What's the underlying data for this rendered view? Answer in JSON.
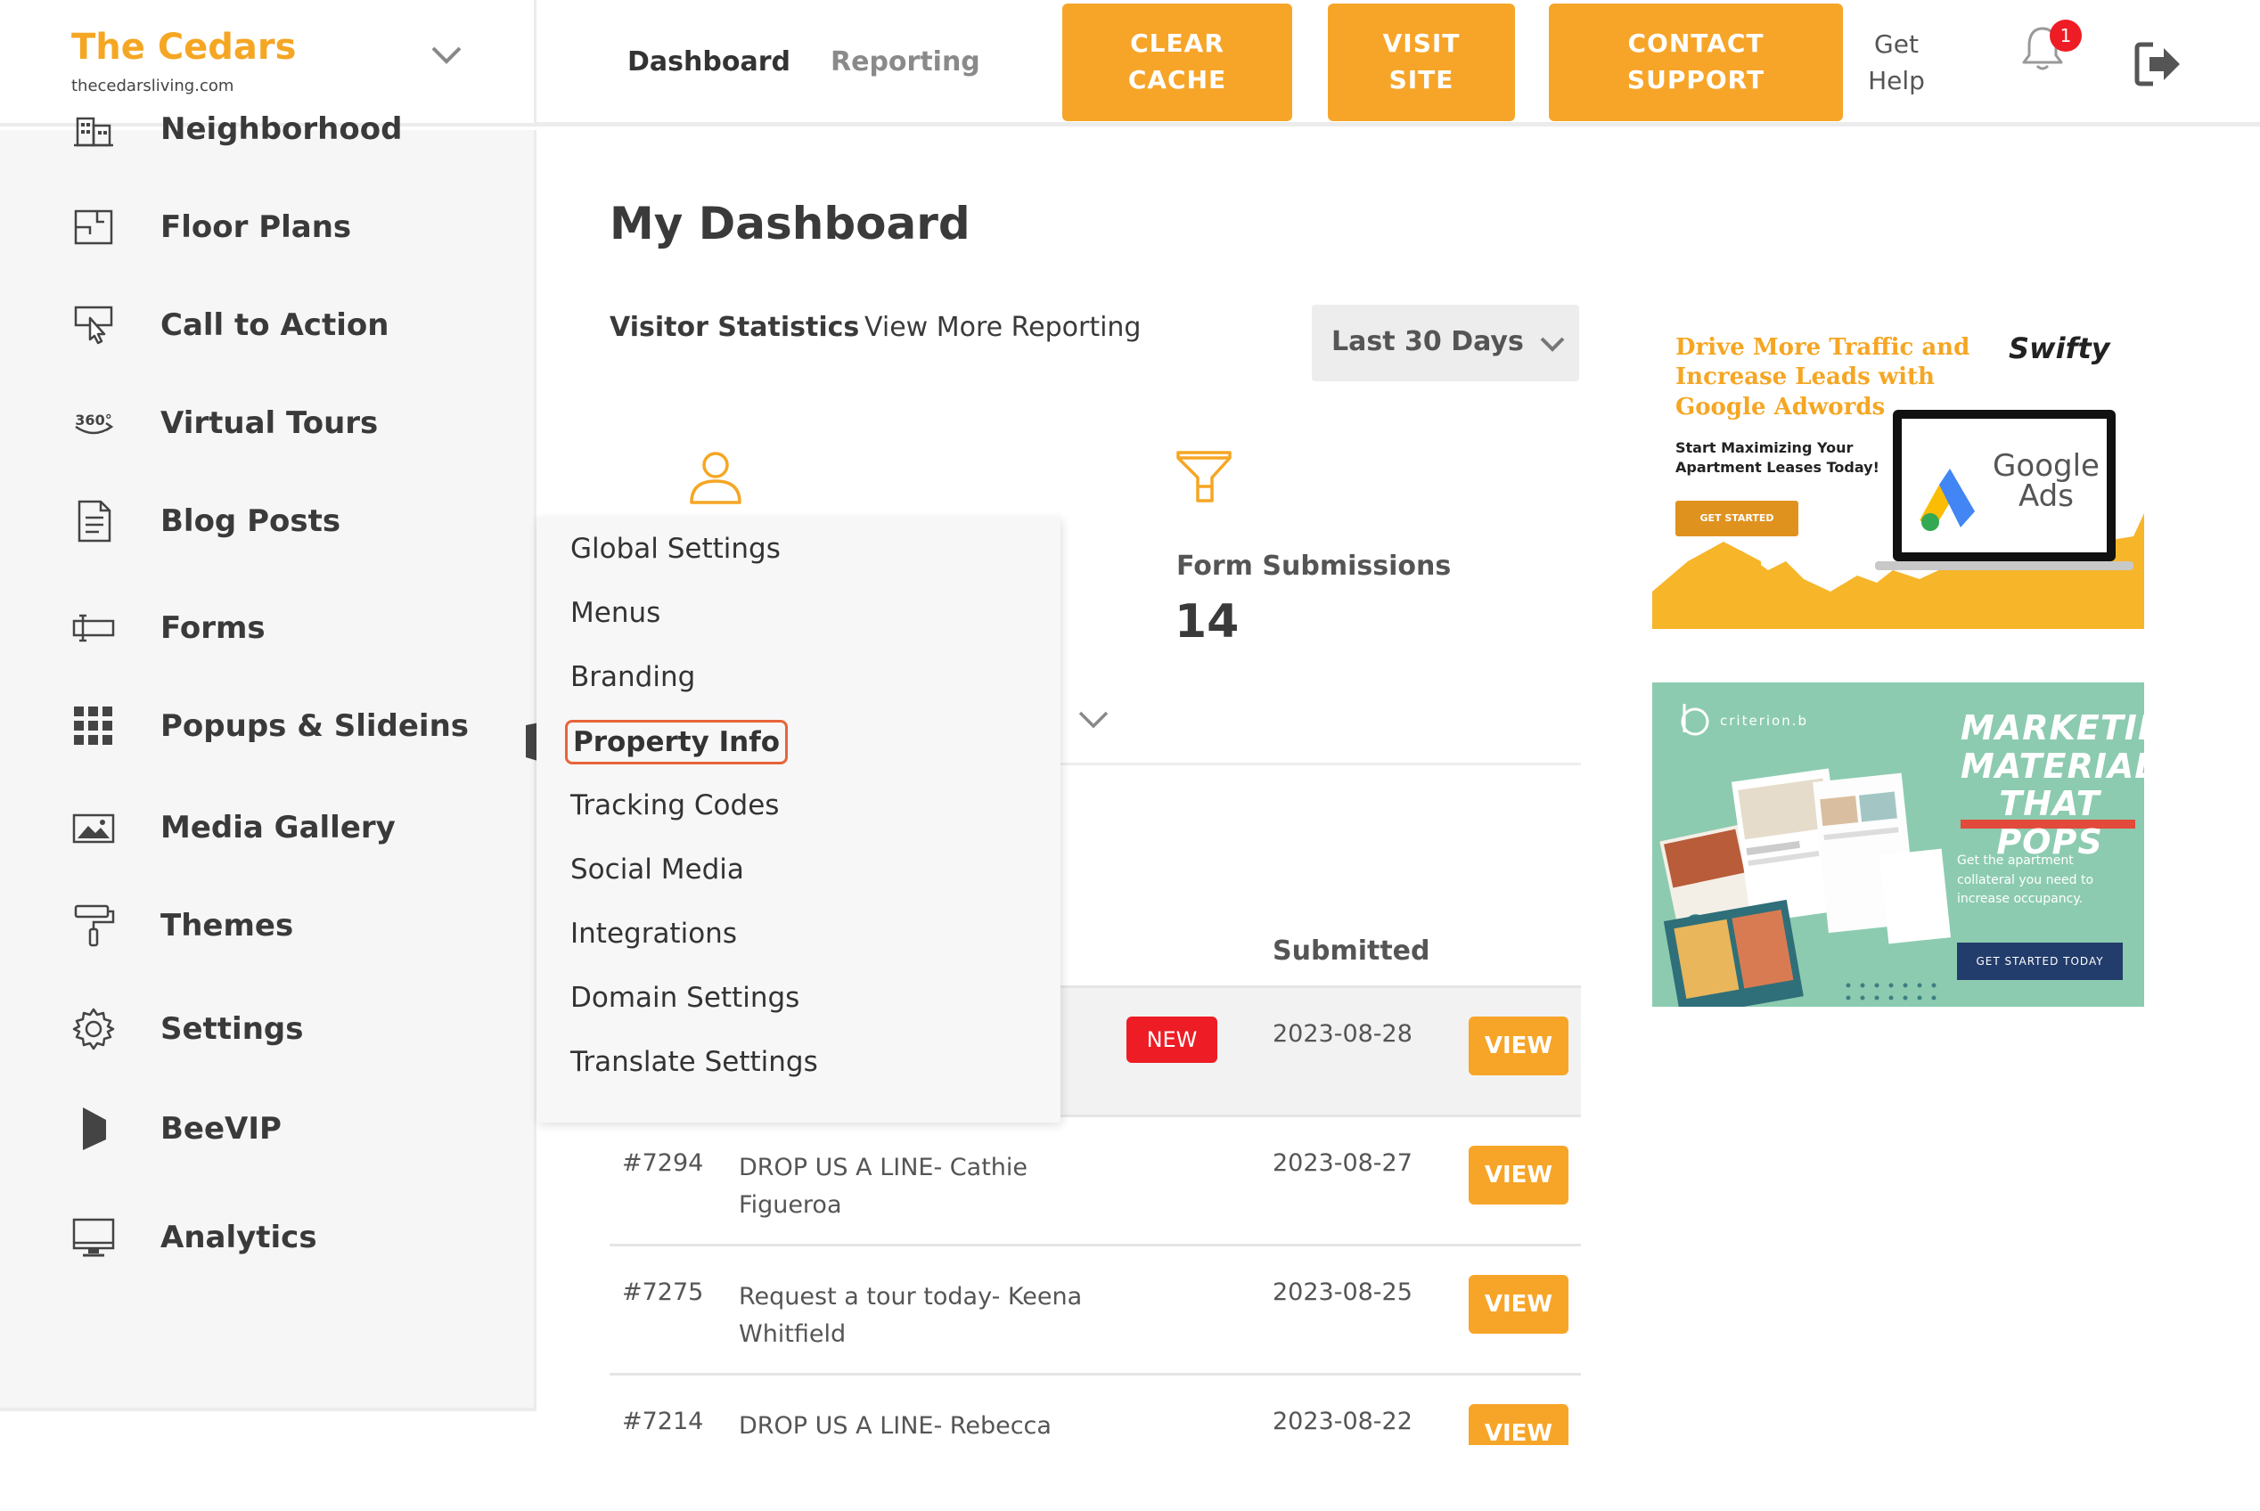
{
  "brand": {
    "name": "The Cedars",
    "url": "thecedarsliving.com",
    "accent": "#f5a623"
  },
  "sidebar": {
    "items": [
      {
        "label": "Neighborhood",
        "icon": "building-icon"
      },
      {
        "label": "Floor Plans",
        "icon": "floor-plan-icon"
      },
      {
        "label": "Call to Action",
        "icon": "pointer-click-icon"
      },
      {
        "label": "Virtual Tours",
        "icon": "360-icon"
      },
      {
        "label": "Blog Posts",
        "icon": "document-icon"
      },
      {
        "label": "Forms",
        "icon": "form-field-icon"
      },
      {
        "label": "Popups & Slideins",
        "icon": "grid-icon"
      },
      {
        "label": "Media Gallery",
        "icon": "image-icon"
      },
      {
        "label": "Themes",
        "icon": "paint-roller-icon"
      },
      {
        "label": "Settings",
        "icon": "gear-icon"
      },
      {
        "label": "BeeVIP",
        "icon": "flag-icon"
      },
      {
        "label": "Analytics",
        "icon": "monitor-icon"
      }
    ]
  },
  "topbar": {
    "tabs": [
      {
        "label": "Dashboard",
        "active": true
      },
      {
        "label": "Reporting",
        "active": false
      }
    ],
    "buttons": {
      "clear_cache": "CLEAR CACHE",
      "visit_site": "VISIT SITE",
      "contact_support": "CONTACT SUPPORT"
    },
    "get_help": "Get Help",
    "notification_count": "1"
  },
  "main": {
    "title": "My Dashboard",
    "visitor_statistics": "Visitor Statistics",
    "view_more": "View More Reporting",
    "period": "Last 30 Days",
    "stats": {
      "form_submissions_label": "Form Submissions",
      "form_submissions_value": "14"
    },
    "table": {
      "submitted_header": "Submitted",
      "rows": [
        {
          "id": "",
          "title": "",
          "badge": "NEW",
          "date": "2023-08-28",
          "action": "VIEW"
        },
        {
          "id": "#7294",
          "title": "DROP US A LINE- Cathie Figueroa",
          "badge": "",
          "date": "2023-08-27",
          "action": "VIEW"
        },
        {
          "id": "#7275",
          "title": "Request a tour today- Keena Whitfield",
          "badge": "",
          "date": "2023-08-25",
          "action": "VIEW"
        },
        {
          "id": "#7214",
          "title": "DROP US A LINE- Rebecca",
          "badge": "",
          "date": "2023-08-22",
          "action": "VIEW"
        }
      ]
    }
  },
  "dropdown": {
    "items": [
      "Global Settings",
      "Menus",
      "Branding",
      "Property Info",
      "Tracking Codes",
      "Social Media",
      "Integrations",
      "Domain Settings",
      "Translate Settings"
    ],
    "focused": "Property Info"
  },
  "ads": {
    "swifty": {
      "title": "Drive More Traffic and Increase Leads with Google Adwords",
      "brand": "Swifty",
      "subtitle": "Start Maximizing Your Apartment Leases Today!",
      "button": "GET STARTED",
      "google_text": "Google Ads"
    },
    "criterion": {
      "logo": "criterion.b",
      "headline": "MARKETING MATERIAL THAT POPS",
      "subtitle": "Get the apartment collateral you need to increase occupancy.",
      "button": "GET STARTED TODAY"
    }
  },
  "colors": {
    "orange": "#f7a529",
    "badge_red": "#ee1c24",
    "teal": "#8ccbb0",
    "navy": "#223c6b"
  }
}
